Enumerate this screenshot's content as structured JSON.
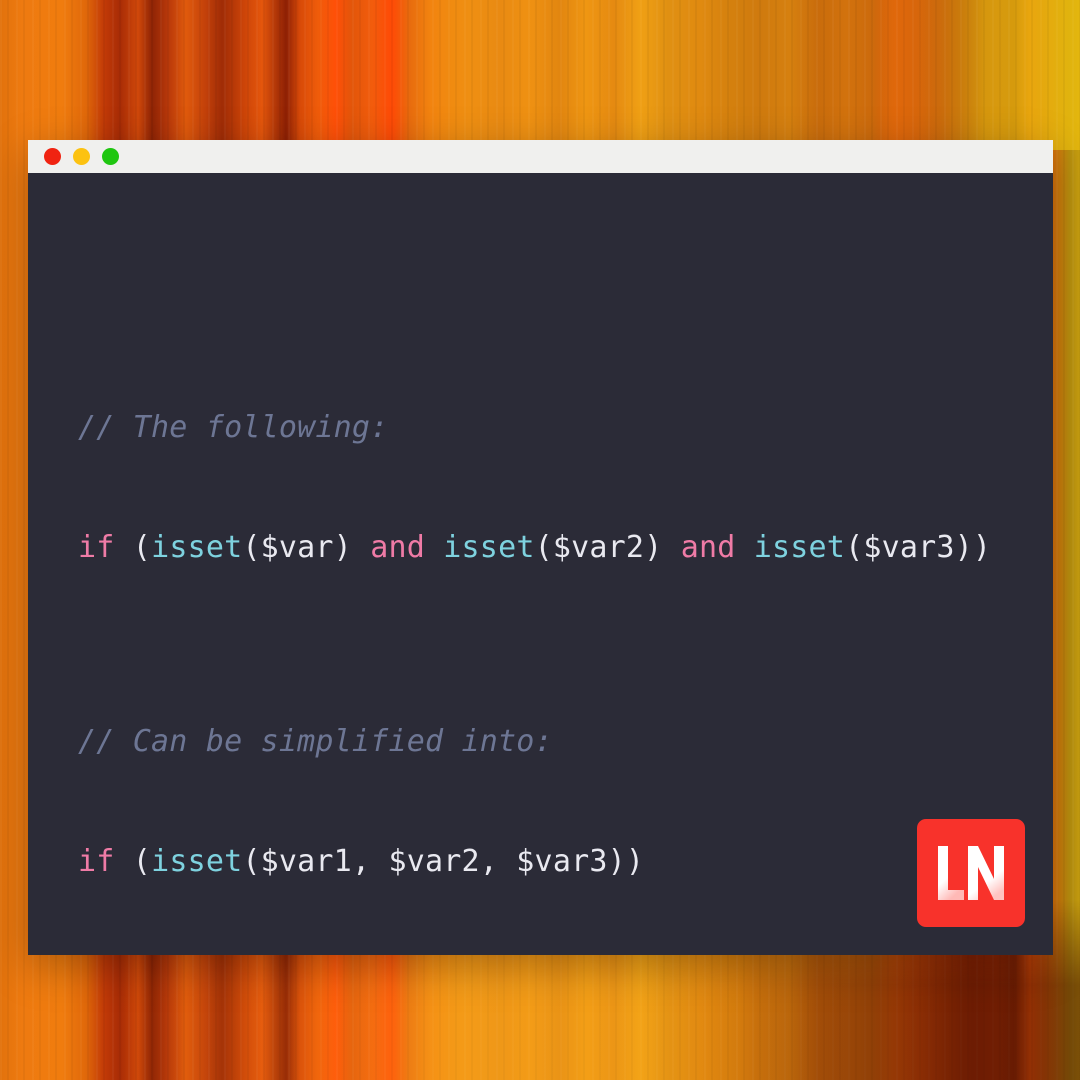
{
  "background": {
    "style_name": "vertical-orange-stripes",
    "colors": {
      "orange": "#ef8f12",
      "deep_orange": "#e2560a",
      "red_orange": "#ff4a06",
      "dark_brown": "#8e2004",
      "golden_yellow": "#d4a412"
    }
  },
  "window": {
    "titlebar": {
      "background": "#f0f0ee",
      "traffic_lights": [
        {
          "name": "close",
          "color": "#f02311"
        },
        {
          "name": "minimize",
          "color": "#fcc211"
        },
        {
          "name": "maximize",
          "color": "#1fc610"
        }
      ]
    },
    "editor": {
      "background": "#2b2b37",
      "language": "php",
      "theme_colors": {
        "comment": "#6d7694",
        "keyword": "#ef7ba6",
        "function": "#7ed2df",
        "plain": "#e9e9f0"
      },
      "lines": [
        {
          "id": "comment-1",
          "type": "comment",
          "text": "// The following:",
          "tokens": [
            {
              "kind": "comment",
              "text": "// The following:"
            }
          ]
        },
        {
          "id": "blank-1",
          "type": "blank",
          "text": "",
          "tokens": []
        },
        {
          "id": "code-1",
          "type": "code",
          "text": "if (isset($var) and isset($var2) and isset($var3))",
          "tokens": [
            {
              "kind": "keyword",
              "text": "if"
            },
            {
              "kind": "plain",
              "text": " ("
            },
            {
              "kind": "function",
              "text": "isset"
            },
            {
              "kind": "plain",
              "text": "($var) "
            },
            {
              "kind": "keyword",
              "text": "and"
            },
            {
              "kind": "plain",
              "text": " "
            },
            {
              "kind": "function",
              "text": "isset"
            },
            {
              "kind": "plain",
              "text": "($var2) "
            },
            {
              "kind": "keyword",
              "text": "and"
            },
            {
              "kind": "plain",
              "text": " "
            },
            {
              "kind": "function",
              "text": "isset"
            },
            {
              "kind": "plain",
              "text": "($var3))"
            }
          ]
        },
        {
          "id": "blank-2",
          "type": "blank",
          "text": "",
          "tokens": []
        },
        {
          "id": "blank-3",
          "type": "blank",
          "text": "",
          "tokens": []
        },
        {
          "id": "comment-2",
          "type": "comment",
          "text": "// Can be simplified into:",
          "tokens": [
            {
              "kind": "comment",
              "text": "// Can be simplified into:"
            }
          ]
        },
        {
          "id": "blank-4",
          "type": "blank",
          "text": "",
          "tokens": []
        },
        {
          "id": "code-2",
          "type": "code",
          "text": "if (isset($var1, $var2, $var3))",
          "tokens": [
            {
              "kind": "keyword",
              "text": "if"
            },
            {
              "kind": "plain",
              "text": " ("
            },
            {
              "kind": "function",
              "text": "isset"
            },
            {
              "kind": "plain",
              "text": "($var1, $var2, $var3))"
            }
          ]
        }
      ]
    }
  },
  "logo": {
    "name": "ln-logo",
    "text": "LN",
    "background_color": "#f8322b",
    "mark_color": "#ffffff"
  }
}
